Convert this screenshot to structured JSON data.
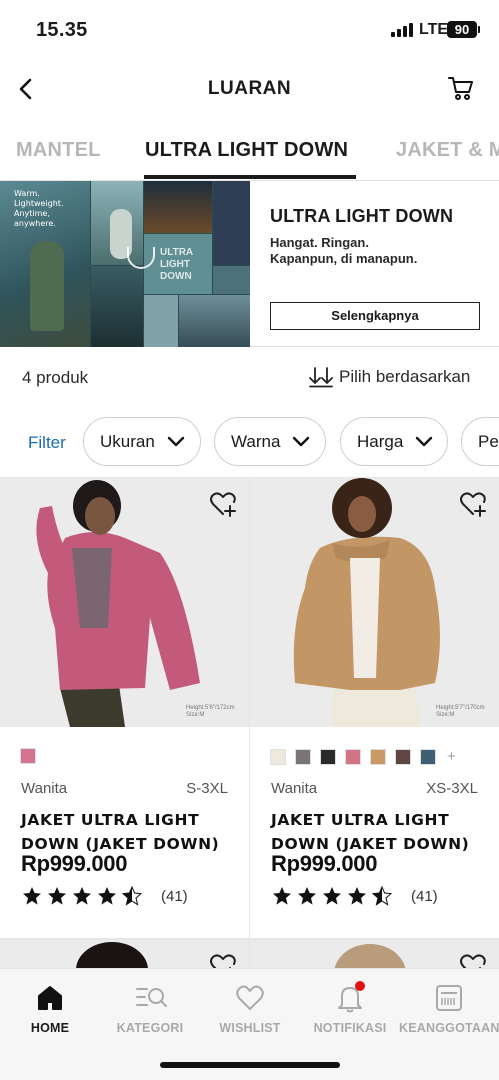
{
  "status_bar": {
    "time": "15.35",
    "network": "LTE",
    "battery": "90"
  },
  "header": {
    "title": "LUARAN",
    "back_icon": "chevron-left-icon",
    "cart_icon": "cart-icon"
  },
  "tabs": [
    {
      "label": "MANTEL",
      "active": false
    },
    {
      "label": "ULTRA LIGHT DOWN",
      "active": true
    },
    {
      "label": "JAKET & M",
      "active": false
    }
  ],
  "banner": {
    "image_caption": [
      "Warm.",
      "Lightweight.",
      "Anytime,",
      "anywhere."
    ],
    "image_logo_text": [
      "ULTRA",
      "LIGHT",
      "DOWN"
    ],
    "heading": "ULTRA LIGHT DOWN",
    "subtitle_1": "Hangat. Ringan.",
    "subtitle_2": "Kapanpun, di manapun.",
    "button": "Selengkapnya"
  },
  "list_meta": {
    "count": "4 produk",
    "sort_label": "Pilih berdasarkan"
  },
  "filters": {
    "label": "Filter",
    "chips": [
      "Ukuran",
      "Warna",
      "Harga",
      "Pe"
    ]
  },
  "products": [
    {
      "gender": "Wanita",
      "sizes": "S-3XL",
      "name": "JAKET ULTRA LIGHT DOWN (JAKET DOWN)",
      "price": "Rp999.000",
      "rating": 4.5,
      "reviews": "(41)",
      "size_note": [
        "Height:5'8\"/172cm",
        "Size:M"
      ],
      "colors": [
        "#d4758f"
      ],
      "more_colors": ""
    },
    {
      "gender": "Wanita",
      "sizes": "XS-3XL",
      "name": "JAKET ULTRA LIGHT DOWN (JAKET DOWN)",
      "price": "Rp999.000",
      "rating": 4.5,
      "reviews": "(41)",
      "size_note": [
        "Height:5'7\"/170cm",
        "Size:M"
      ],
      "colors": [
        "#efe8dc",
        "#7b7477",
        "#2a2a2a",
        "#d27486",
        "#c99a66",
        "#5f4644",
        "#3f5f74"
      ],
      "more_colors": "+"
    }
  ],
  "tabbar": [
    {
      "label": "HOME",
      "icon": "home-icon",
      "active": true
    },
    {
      "label": "KATEGORI",
      "icon": "category-search-icon",
      "active": false
    },
    {
      "label": "WISHLIST",
      "icon": "heart-icon",
      "active": false
    },
    {
      "label": "NOTIFIKASI",
      "icon": "bell-icon",
      "active": false
    },
    {
      "label": "KEANGGOTAAN",
      "icon": "membership-card-icon",
      "active": false
    }
  ],
  "colors": {
    "accent_blue": "#1a6bb5",
    "notification_red": "#e31212",
    "text_dark": "#1b1b1b",
    "muted": "#b7b7b7"
  }
}
